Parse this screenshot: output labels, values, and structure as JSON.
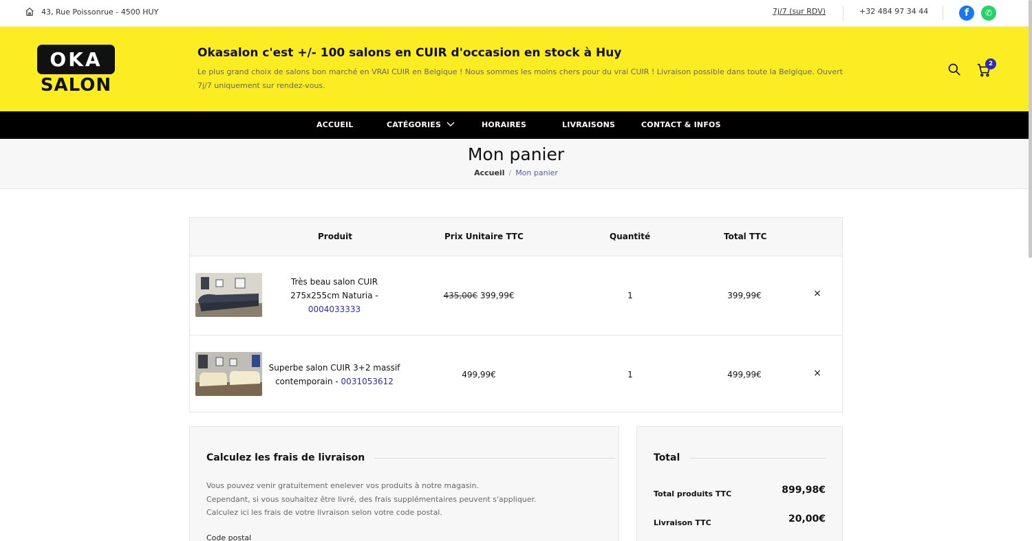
{
  "topbar": {
    "address": "43, Rue Poissonrue - 4500 HUY",
    "hours": "7j/7 (sur RDV)",
    "phone": "+32 484 97 34 44",
    "facebook_letter": "f",
    "whatsapp_letter": "✆"
  },
  "header": {
    "logo_top": "OKA",
    "logo_bottom": "SALON",
    "title": "Okasalon c'est +/- 100 salons en CUIR d'occasion en stock à Huy",
    "subtitle": "Le plus grand choix de salons bon marché en VRAI CUIR en Belgique ! Nous sommes les moins chers pour du vrai CUIR ! Livraison possible dans toute la Belgique. Ouvert 7j/7 uniquement sur rendez-vous.",
    "cart_count": "2",
    "brand_color": "#fcec22"
  },
  "nav": {
    "items": [
      "ACCUEIL",
      "CATÉGORIES",
      "HORAIRES",
      "LIVRAISONS",
      "CONTACT & INFOS"
    ]
  },
  "page": {
    "title": "Mon panier",
    "breadcrumb_home": "Accueil",
    "breadcrumb_sep": "/",
    "breadcrumb_current": "Mon panier"
  },
  "cart": {
    "headers": {
      "product": "Produit",
      "unit_price": "Prix Unitaire TTC",
      "quantity": "Quantité",
      "total": "Total TTC"
    },
    "rows": [
      {
        "name": "Très beau salon CUIR 275x255cm Naturia - ",
        "ref": "0004033333",
        "old_price": "435,00€",
        "price": "399,99€",
        "quantity": "1",
        "total": "399,99€",
        "remove": "×"
      },
      {
        "name": "Superbe salon CUIR 3+2 massif contemporain - ",
        "ref": "0031053612",
        "old_price": "",
        "price": "499,99€",
        "quantity": "1",
        "total": "499,99€",
        "remove": "×"
      }
    ]
  },
  "shipping": {
    "title": "Calculez les frais de livraison",
    "line1": "Vous pouvez venir gratuitement enelever vos produits à notre magasin.",
    "line2": "Cependant, si vous souhaitez être livré, des frais supplémentaires peuvent s'appliquer.",
    "line3": "Calculez ici les frais de votre livraison selon votre code postal.",
    "postcode_label": "Code postal"
  },
  "totals": {
    "title": "Total",
    "products_label": "Total produits TTC",
    "products_value": "899,98€",
    "delivery_label": "Livraison TTC",
    "delivery_value": "20,00€"
  }
}
